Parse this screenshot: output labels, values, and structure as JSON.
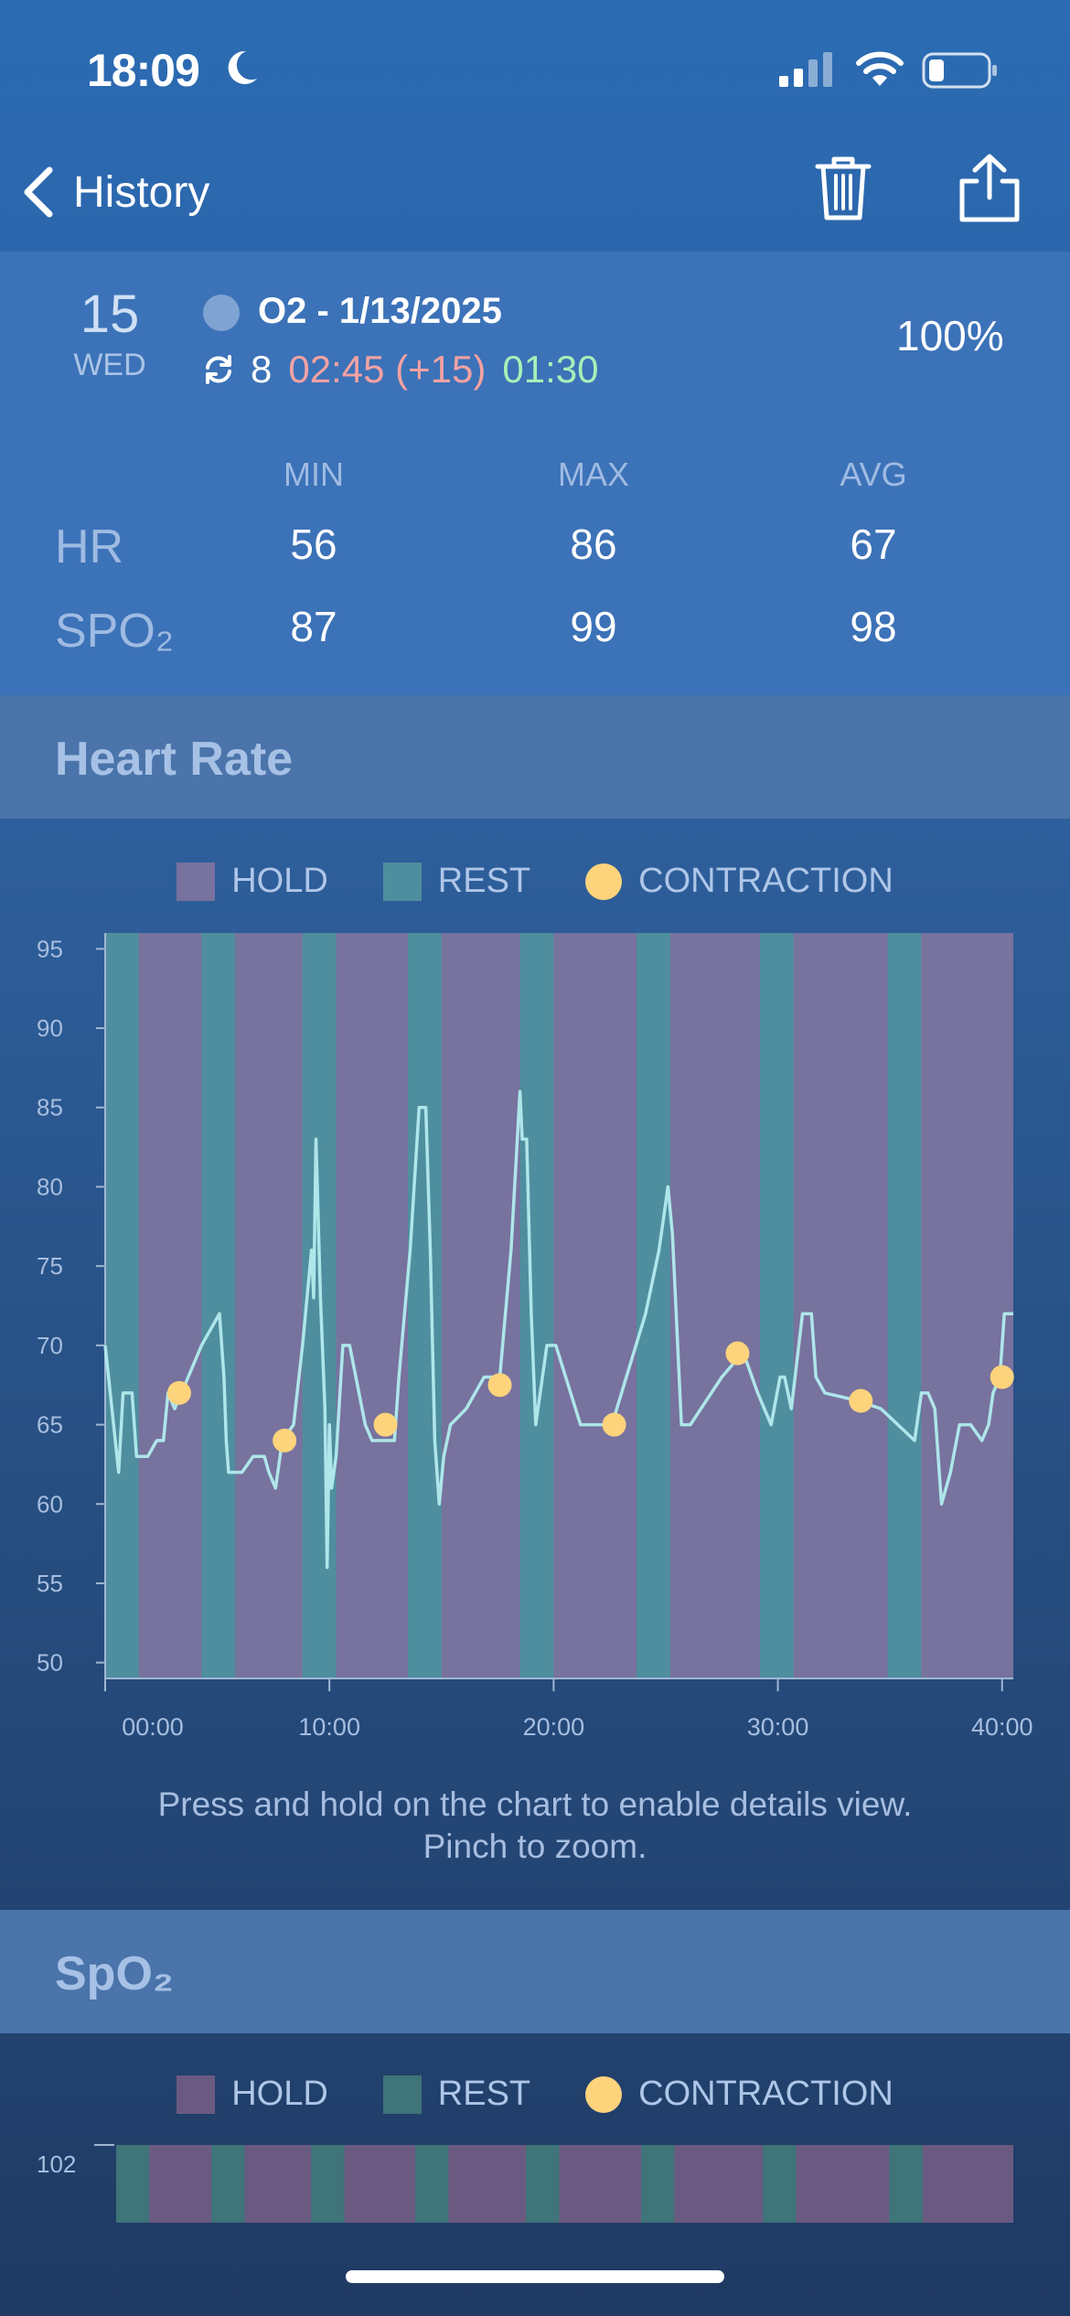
{
  "status_bar": {
    "time": "18:09"
  },
  "nav": {
    "back_label": "History"
  },
  "summary": {
    "day_number": "15",
    "day_name": "WED",
    "session_title": "O2 - 1/13/2025",
    "cycles": "8",
    "hold_time": "02:45 (+15)",
    "rest_time": "01:30",
    "battery": "100%"
  },
  "stats": {
    "columns": [
      "MIN",
      "MAX",
      "AVG"
    ],
    "rows": [
      {
        "label": "HR",
        "min": "56",
        "max": "86",
        "avg": "67"
      },
      {
        "label": "SPO₂",
        "min": "87",
        "max": "99",
        "avg": "98"
      }
    ]
  },
  "heart_rate_section": {
    "title": "Heart Rate"
  },
  "spo2_section": {
    "title": "SpO₂"
  },
  "legend": {
    "hold": "HOLD",
    "rest": "REST",
    "contraction": "CONTRACTION"
  },
  "hint": {
    "line1": "Press and hold on the chart to enable details view.",
    "line2": "Pinch to zoom."
  },
  "colors": {
    "hold": "#77729e",
    "rest": "#4f8e9e",
    "contraction": "#fdd37c",
    "line": "#aee6ea"
  },
  "chart_data": [
    {
      "type": "line",
      "title": "Heart Rate",
      "x_unit": "minutes",
      "y_ticks": [
        95,
        90,
        85,
        80,
        75,
        70,
        65,
        60,
        55,
        50
      ],
      "x_ticks": [
        "00:00",
        "10:00",
        "20:00",
        "30:00",
        "40:00"
      ],
      "ylim": [
        49,
        96
      ],
      "xlim": [
        0,
        40.5
      ],
      "rest_bands": [
        [
          0,
          1.5
        ],
        [
          4.3,
          5.8
        ],
        [
          8.8,
          10.3
        ],
        [
          13.5,
          15
        ],
        [
          18.5,
          20
        ],
        [
          23.7,
          25.2
        ],
        [
          29.2,
          30.7
        ],
        [
          34.9,
          36.4
        ]
      ],
      "series": [
        {
          "points": [
            [
              0,
              70
            ],
            [
              0.3,
              66
            ],
            [
              0.6,
              62
            ],
            [
              0.8,
              67
            ],
            [
              1.2,
              67
            ],
            [
              1.4,
              63
            ],
            [
              1.9,
              63
            ],
            [
              2.3,
              64
            ],
            [
              2.6,
              64
            ],
            [
              2.8,
              67
            ],
            [
              3.1,
              66
            ],
            [
              3.4,
              67
            ],
            [
              4.3,
              70
            ],
            [
              5.1,
              72
            ],
            [
              5.3,
              68
            ],
            [
              5.4,
              64
            ],
            [
              5.5,
              62
            ],
            [
              6.1,
              62
            ],
            [
              6.6,
              63
            ],
            [
              7.1,
              63
            ],
            [
              7.3,
              62
            ],
            [
              7.6,
              61
            ],
            [
              7.9,
              64
            ],
            [
              8.4,
              65
            ],
            [
              8.8,
              70
            ],
            [
              9.2,
              76
            ],
            [
              9.3,
              73
            ],
            [
              9.4,
              83
            ],
            [
              9.6,
              73
            ],
            [
              9.8,
              66
            ],
            [
              9.9,
              56
            ],
            [
              10.0,
              65
            ],
            [
              10.1,
              61
            ],
            [
              10.3,
              63
            ],
            [
              10.6,
              70
            ],
            [
              10.9,
              70
            ],
            [
              11.6,
              65
            ],
            [
              11.9,
              64
            ],
            [
              12.4,
              64
            ],
            [
              12.9,
              64
            ],
            [
              13.1,
              68
            ],
            [
              13.6,
              76
            ],
            [
              14.0,
              85
            ],
            [
              14.3,
              85
            ],
            [
              14.5,
              76
            ],
            [
              14.7,
              64
            ],
            [
              14.9,
              60
            ],
            [
              15.1,
              63
            ],
            [
              15.4,
              65
            ],
            [
              16.1,
              66
            ],
            [
              16.9,
              68
            ],
            [
              17.6,
              68
            ],
            [
              18.1,
              76
            ],
            [
              18.5,
              86
            ],
            [
              18.6,
              83
            ],
            [
              18.8,
              83
            ],
            [
              19.0,
              72
            ],
            [
              19.2,
              65
            ],
            [
              19.7,
              70
            ],
            [
              20.1,
              70
            ],
            [
              21.2,
              65
            ],
            [
              22.6,
              65
            ],
            [
              24.1,
              72
            ],
            [
              24.7,
              76
            ],
            [
              25.1,
              80
            ],
            [
              25.3,
              77
            ],
            [
              25.7,
              65
            ],
            [
              26.1,
              65
            ],
            [
              27.5,
              68
            ],
            [
              28.1,
              69
            ],
            [
              28.6,
              69
            ],
            [
              29.1,
              67
            ],
            [
              29.7,
              65
            ],
            [
              30.1,
              68
            ],
            [
              30.3,
              68
            ],
            [
              30.6,
              66
            ],
            [
              31.1,
              72
            ],
            [
              31.5,
              72
            ],
            [
              31.7,
              68
            ],
            [
              32.1,
              67
            ],
            [
              33.6,
              66.5
            ],
            [
              34.6,
              66
            ],
            [
              36.1,
              64
            ],
            [
              36.4,
              67
            ],
            [
              36.7,
              67
            ],
            [
              37.0,
              66
            ],
            [
              37.3,
              60
            ],
            [
              37.7,
              62
            ],
            [
              38.1,
              65
            ],
            [
              38.6,
              65
            ],
            [
              39.1,
              64
            ],
            [
              39.4,
              65
            ],
            [
              39.6,
              67
            ],
            [
              39.9,
              68
            ],
            [
              40.1,
              72
            ],
            [
              40.5,
              72
            ]
          ]
        }
      ],
      "contractions": [
        [
          3.3,
          67
        ],
        [
          8.0,
          64
        ],
        [
          12.5,
          65
        ],
        [
          17.6,
          67.5
        ],
        [
          22.7,
          65
        ],
        [
          28.2,
          69.5
        ],
        [
          33.7,
          66.5
        ],
        [
          40.0,
          68
        ]
      ]
    },
    {
      "type": "line",
      "title": "SpO₂",
      "y_ticks": [
        102
      ],
      "rest_bands": [
        [
          0,
          1.5
        ],
        [
          4.3,
          5.8
        ],
        [
          8.8,
          10.3
        ],
        [
          13.5,
          15
        ],
        [
          18.5,
          20
        ],
        [
          23.7,
          25.2
        ],
        [
          29.2,
          30.7
        ],
        [
          34.9,
          36.4
        ]
      ]
    }
  ]
}
